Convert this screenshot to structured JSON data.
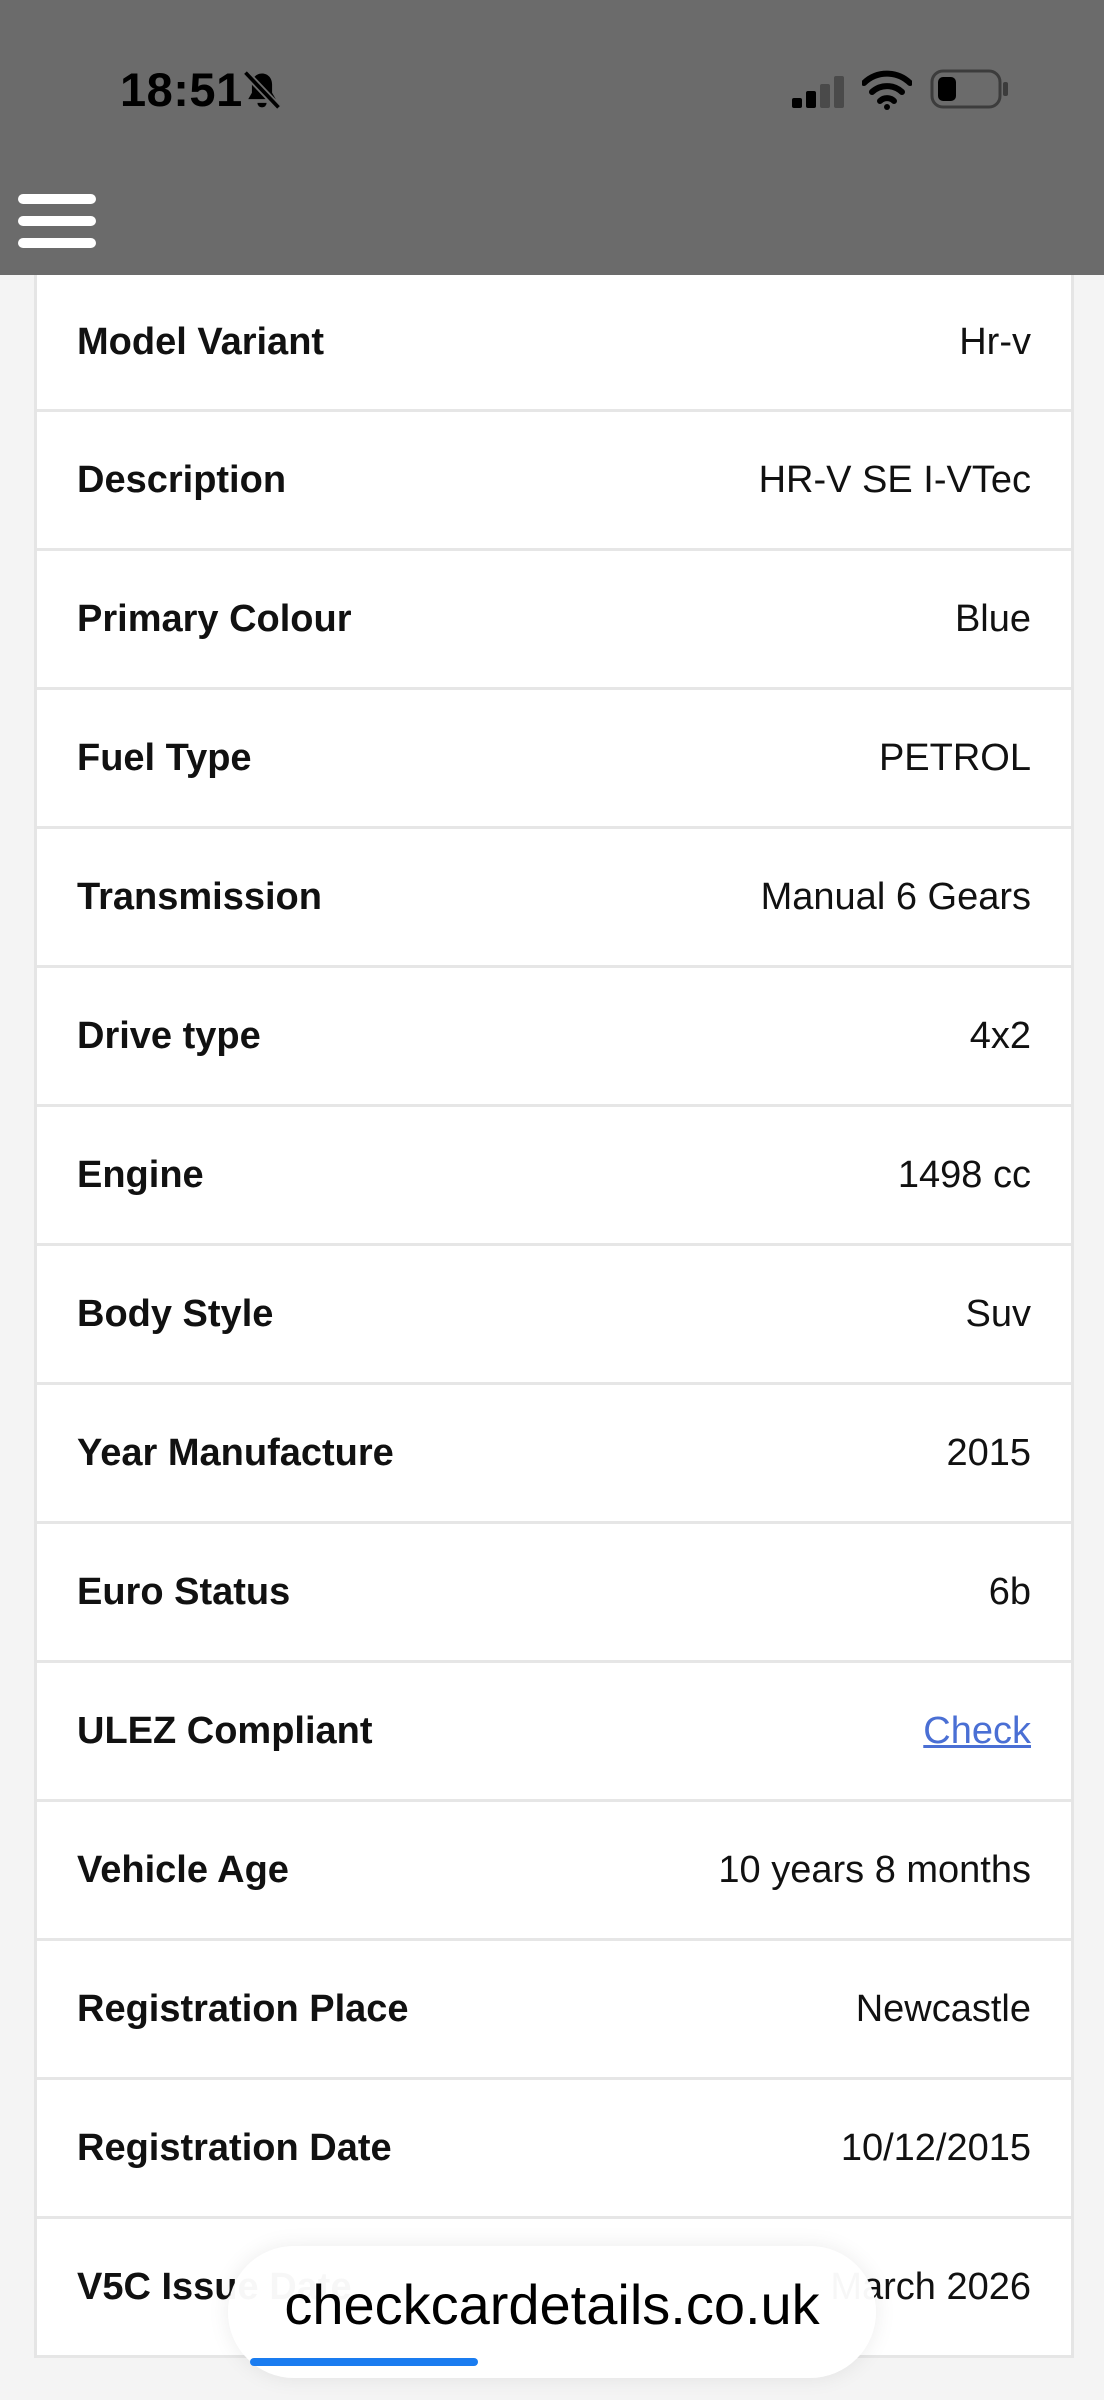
{
  "status_bar": {
    "time": "18:51"
  },
  "details": [
    {
      "label": "Model Variant",
      "value": "Hr-v"
    },
    {
      "label": "Description",
      "value": "HR-V SE I-VTec"
    },
    {
      "label": "Primary Colour",
      "value": "Blue"
    },
    {
      "label": "Fuel Type",
      "value": "PETROL"
    },
    {
      "label": "Transmission",
      "value": "Manual 6 Gears"
    },
    {
      "label": "Drive type",
      "value": "4x2"
    },
    {
      "label": "Engine",
      "value": "1498 cc"
    },
    {
      "label": "Body Style",
      "value": "Suv"
    },
    {
      "label": "Year Manufacture",
      "value": "2015"
    },
    {
      "label": "Euro Status",
      "value": "6b"
    },
    {
      "label": "ULEZ Compliant",
      "value": "Check"
    },
    {
      "label": "Vehicle Age",
      "value": "10 years 8 months"
    },
    {
      "label": "Registration Place",
      "value": "Newcastle"
    },
    {
      "label": "Registration Date",
      "value": "10/12/2015"
    },
    {
      "label": "V5C Issue Date",
      "value": "March 2026"
    }
  ],
  "browser": {
    "url": "checkcardetails.co.uk",
    "load_progress": 0.5
  },
  "colors": {
    "header_bg": "#6b6b6b",
    "link": "#4a6fd4",
    "progress": "#1a7cf0"
  }
}
